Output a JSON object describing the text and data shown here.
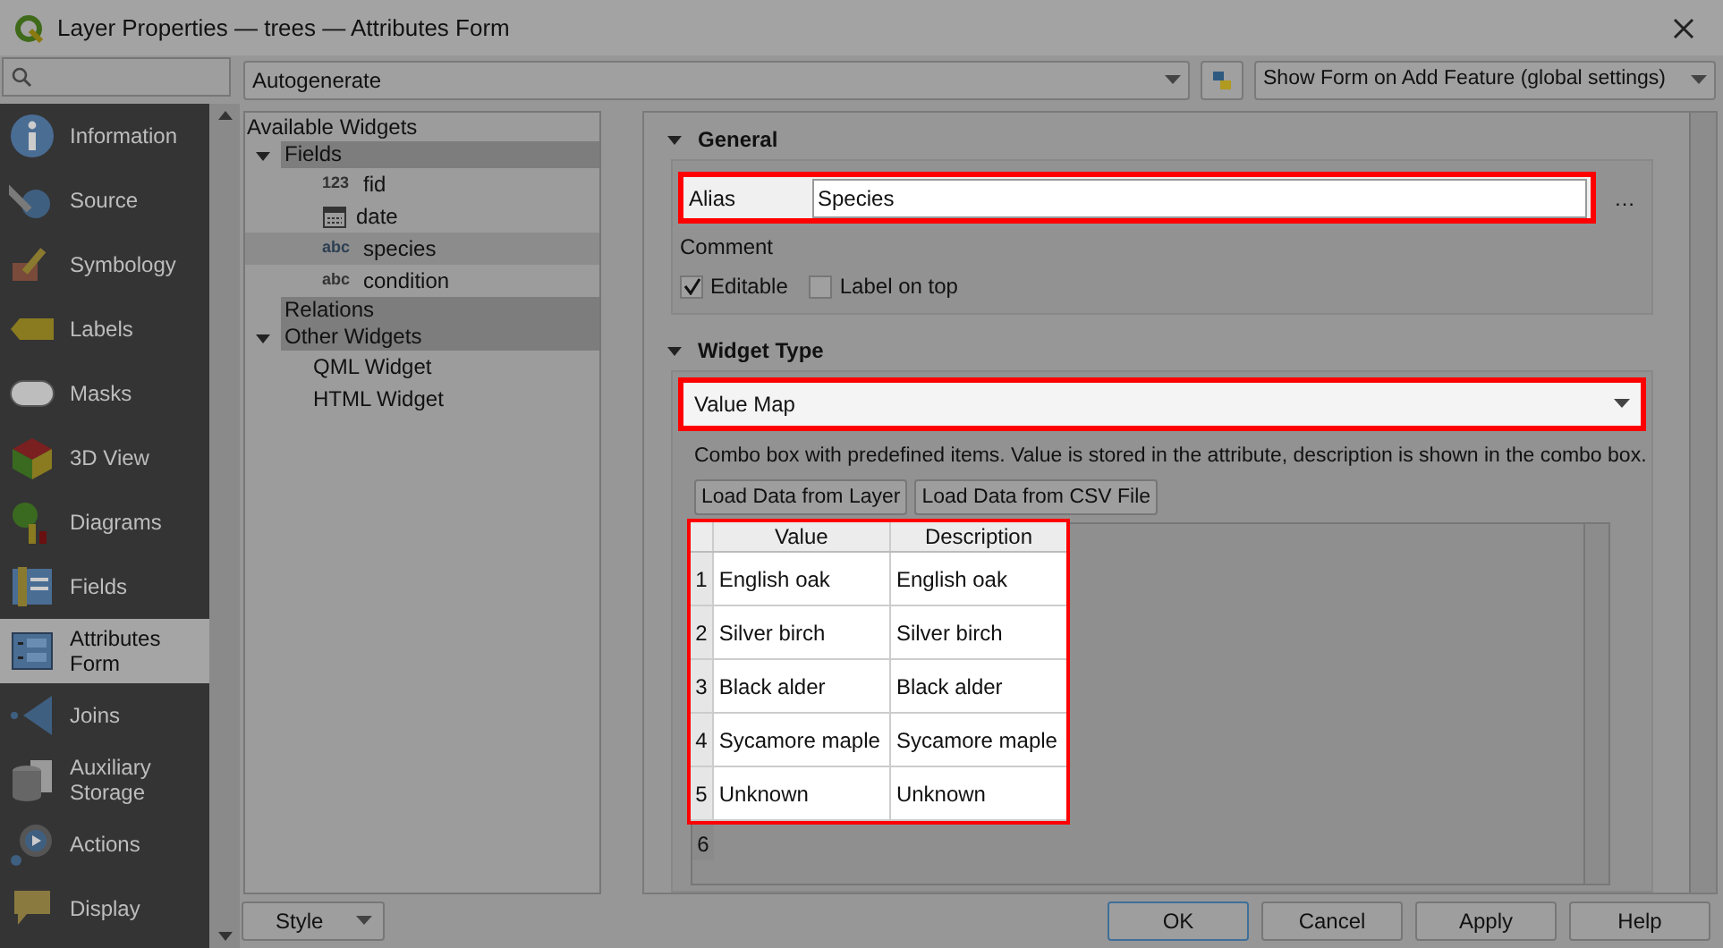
{
  "window": {
    "title": "Layer Properties — trees — Attributes Form"
  },
  "toolbar": {
    "layout_select": "Autogenerate",
    "form_option_select": "Show Form on Add Feature (global settings)"
  },
  "sidebar": {
    "items": [
      {
        "label": "Information",
        "selected": false
      },
      {
        "label": "Source",
        "selected": false
      },
      {
        "label": "Symbology",
        "selected": false
      },
      {
        "label": "Labels",
        "selected": false
      },
      {
        "label": "Masks",
        "selected": false
      },
      {
        "label": "3D View",
        "selected": false
      },
      {
        "label": "Diagrams",
        "selected": false
      },
      {
        "label": "Fields",
        "selected": false
      },
      {
        "label": "Attributes Form",
        "selected": true
      },
      {
        "label": "Joins",
        "selected": false
      },
      {
        "label": "Auxiliary Storage",
        "selected": false
      },
      {
        "label": "Actions",
        "selected": false
      },
      {
        "label": "Display",
        "selected": false
      }
    ]
  },
  "widgets_tree": {
    "title": "Available Widgets",
    "groups": [
      {
        "label": "Fields",
        "expanded": true,
        "children": [
          {
            "label": "fid",
            "kind": "number",
            "badge": "123",
            "selected": false
          },
          {
            "label": "date",
            "kind": "date",
            "selected": false
          },
          {
            "label": "species",
            "kind": "text",
            "badge": "abc",
            "selected": true
          },
          {
            "label": "condition",
            "kind": "text",
            "badge": "abc",
            "selected": false
          }
        ]
      },
      {
        "label": "Relations"
      },
      {
        "label": "Other Widgets",
        "expanded": true,
        "children": [
          {
            "label": "QML Widget",
            "kind": "plain",
            "selected": false
          },
          {
            "label": "HTML Widget",
            "kind": "plain",
            "selected": false
          }
        ]
      }
    ]
  },
  "general": {
    "title": "General",
    "expanded": true,
    "alias_label": "Alias",
    "alias_value": "Species",
    "alias_highlighted": true,
    "more_button": "…",
    "comment_label": "Comment",
    "checkboxes": [
      {
        "label": "Editable",
        "checked": true
      },
      {
        "label": "Label on top",
        "checked": false
      }
    ]
  },
  "widget_type": {
    "title": "Widget Type",
    "expanded": true,
    "select": "Value Map",
    "select_highlighted": true,
    "description": "Combo box with predefined items. Value is stored in the attribute, description is shown in the combo box.",
    "buttons": [
      "Load Data from Layer",
      "Load Data from CSV File"
    ],
    "table": {
      "highlighted": true,
      "columns": [
        "Value",
        "Description"
      ],
      "rows": [
        {
          "index": "1",
          "value": "English oak",
          "description": "English oak"
        },
        {
          "index": "2",
          "value": "Silver birch",
          "description": "Silver birch"
        },
        {
          "index": "3",
          "value": "Black alder",
          "description": "Black alder"
        },
        {
          "index": "4",
          "value": "Sycamore maple",
          "description": "Sycamore maple"
        },
        {
          "index": "5",
          "value": "Unknown",
          "description": "Unknown"
        },
        {
          "index": "6"
        }
      ]
    }
  },
  "footer": {
    "style_button": "Style",
    "buttons": [
      {
        "label": "OK",
        "default": true
      },
      {
        "label": "Cancel",
        "default": false
      },
      {
        "label": "Apply",
        "default": false
      },
      {
        "label": "Help",
        "default": false
      }
    ]
  }
}
